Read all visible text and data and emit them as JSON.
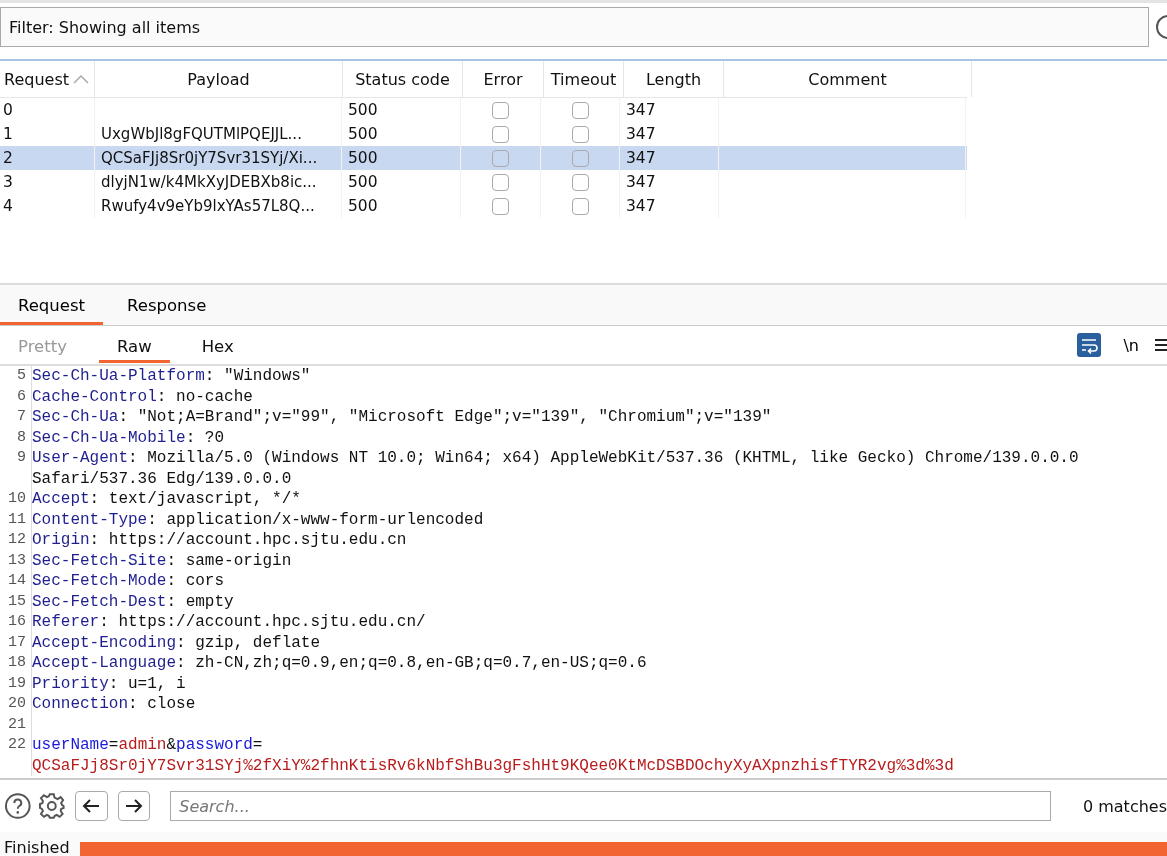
{
  "filter": {
    "value": "Filter: Showing all items"
  },
  "table": {
    "columns": [
      {
        "label": "Request",
        "sorted": true
      },
      {
        "label": "Payload",
        "sorted": false
      },
      {
        "label": "Status code",
        "sorted": false
      },
      {
        "label": "Error",
        "sorted": false
      },
      {
        "label": "Timeout",
        "sorted": false
      },
      {
        "label": "Length",
        "sorted": false
      },
      {
        "label": "Comment",
        "sorted": false
      }
    ],
    "rows": [
      {
        "request": "0",
        "payload": "",
        "status": "500",
        "error": false,
        "timeout": false,
        "length": "347",
        "comment": "",
        "selected": false
      },
      {
        "request": "1",
        "payload": "UxgWbJl8gFQUTMlPQEJJL...",
        "status": "500",
        "error": false,
        "timeout": false,
        "length": "347",
        "comment": "",
        "selected": false
      },
      {
        "request": "2",
        "payload": "QCSaFJj8Sr0jY7Svr31SYj/Xi...",
        "status": "500",
        "error": false,
        "timeout": false,
        "length": "347",
        "comment": "",
        "selected": true
      },
      {
        "request": "3",
        "payload": "dlyjN1w/k4MkXyJDEBXb8ic...",
        "status": "500",
        "error": false,
        "timeout": false,
        "length": "347",
        "comment": "",
        "selected": false
      },
      {
        "request": "4",
        "payload": "Rwufy4v9eYb9lxYAs57L8Q...",
        "status": "500",
        "error": false,
        "timeout": false,
        "length": "347",
        "comment": "",
        "selected": false
      }
    ]
  },
  "message_tabs": [
    {
      "label": "Request",
      "selected": true
    },
    {
      "label": "Response",
      "selected": false
    }
  ],
  "view_tabs": [
    {
      "label": "Pretty",
      "selected": false,
      "disabled": true
    },
    {
      "label": "Raw",
      "selected": true,
      "disabled": false
    },
    {
      "label": "Hex",
      "selected": false,
      "disabled": false
    }
  ],
  "toolbar": {
    "wrap_on": true,
    "newline_toggle": "\\n"
  },
  "editor_lines": [
    {
      "number": "5",
      "kind": "header",
      "name": "Sec-Ch-Ua-Platform",
      "colon": ":",
      "value": "\"Windows\""
    },
    {
      "number": "6",
      "kind": "header",
      "name": "Cache-Control",
      "colon": ":",
      "value": "no-cache"
    },
    {
      "number": "7",
      "kind": "header",
      "name": "Sec-Ch-Ua",
      "colon": ":",
      "value": "\"Not;A=Brand\";v=\"99\", \"Microsoft Edge\";v=\"139\", \"Chromium\";v=\"139\""
    },
    {
      "number": "8",
      "kind": "header",
      "name": "Sec-Ch-Ua-Mobile",
      "colon": ":",
      "value": "?0"
    },
    {
      "number": "9",
      "kind": "header",
      "name": "User-Agent",
      "colon": ":",
      "value": "Mozilla/5.0 (Windows NT 10.0; Win64; x64) AppleWebKit/537.36 (KHTML, like Gecko) Chrome/139.0.0.0",
      "wrap": "Safari/537.36 Edg/139.0.0.0"
    },
    {
      "number": "10",
      "kind": "header",
      "name": "Accept",
      "colon": ":",
      "value": "text/javascript, */*"
    },
    {
      "number": "11",
      "kind": "header",
      "name": "Content-Type",
      "colon": ":",
      "value": "application/x-www-form-urlencoded"
    },
    {
      "number": "12",
      "kind": "header",
      "name": "Origin",
      "colon": ":",
      "value": "https://account.hpc.sjtu.edu.cn"
    },
    {
      "number": "13",
      "kind": "header",
      "name": "Sec-Fetch-Site",
      "colon": ":",
      "value": "same-origin"
    },
    {
      "number": "14",
      "kind": "header",
      "name": "Sec-Fetch-Mode",
      "colon": ":",
      "value": "cors"
    },
    {
      "number": "15",
      "kind": "header",
      "name": "Sec-Fetch-Dest",
      "colon": ":",
      "value": "empty"
    },
    {
      "number": "16",
      "kind": "header",
      "name": "Referer",
      "colon": ":",
      "value": "https://account.hpc.sjtu.edu.cn/"
    },
    {
      "number": "17",
      "kind": "header",
      "name": "Accept-Encoding",
      "colon": ":",
      "value": "gzip, deflate"
    },
    {
      "number": "18",
      "kind": "header",
      "name": "Accept-Language",
      "colon": ":",
      "value": "zh-CN,zh;q=0.9,en;q=0.8,en-GB;q=0.7,en-US;q=0.6"
    },
    {
      "number": "19",
      "kind": "header",
      "name": "Priority",
      "colon": ":",
      "value": "u=1, i"
    },
    {
      "number": "20",
      "kind": "header",
      "name": "Connection",
      "colon": ":",
      "value": "close"
    },
    {
      "number": "21",
      "kind": "blank"
    },
    {
      "number": "22",
      "kind": "params",
      "parts": [
        {
          "kind": "key",
          "text": "userName"
        },
        {
          "kind": "sep",
          "text": "="
        },
        {
          "kind": "value",
          "text": "admin"
        },
        {
          "kind": "sep",
          "text": "&"
        },
        {
          "kind": "key",
          "text": "password"
        },
        {
          "kind": "sep",
          "text": "="
        }
      ],
      "wrap": "QCSaFJj8Sr0jY7Svr31SYj%2fXiY%2fhnKtisRv6kNbfShBu3gFshHt9KQee0KtMcDSBDOchyXyAXpnzhisfTYR2vg%3d%3d"
    }
  ],
  "search": {
    "placeholder": "Search...",
    "matches": "0 matches"
  },
  "status": {
    "label": "Finished",
    "level": 1
  }
}
